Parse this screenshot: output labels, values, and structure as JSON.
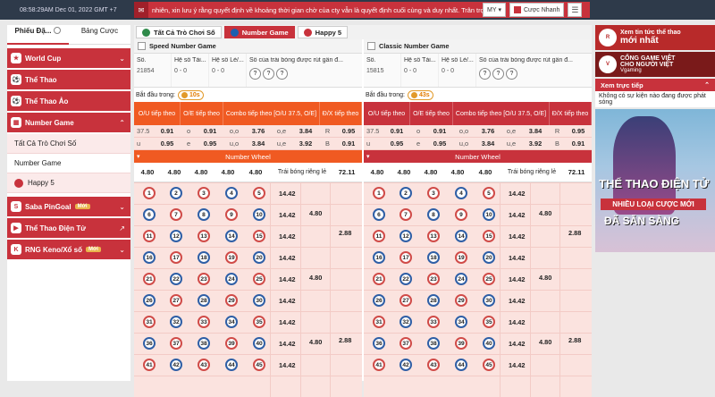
{
  "topbar": {
    "datetime": "08:58:29AM Dec 01, 2022 GMT +7",
    "marquee": "nhiên, xin lưu ý rằng quyết định về khoảng thời gian chờ của cty vẫn là quyết định cuối cùng và duy nhất. Trân trọng.",
    "lang": "MY",
    "quick_bet": "Cược Nhanh"
  },
  "sidebar": {
    "tabs": [
      "Phiếu Đặ...",
      "Bảng Cược"
    ],
    "items": [
      {
        "label": "World Cup"
      },
      {
        "label": "Thể Thao"
      },
      {
        "label": "Thể Thao Ảo"
      },
      {
        "label": "Number Game"
      }
    ],
    "subitems": [
      "Tất Cả Trò Chơi Số",
      "Number Game",
      "Happy 5"
    ],
    "bottom": [
      {
        "label": "Saba PinGoal",
        "badge": "Mới"
      },
      {
        "label": "Thể Thao Điện Tử"
      },
      {
        "label": "RNG Keno/Xổ số",
        "badge": "Mới"
      }
    ]
  },
  "game_tabs": [
    "Tất Cả Trò Chơi Số",
    "Number Game",
    "Happy 5"
  ],
  "panels": [
    {
      "title": "Speed Number Game",
      "head": {
        "so_label": "Số.",
        "so_value": "21854",
        "tai_label": "Hệ số Tài...",
        "tai_value": "0 - 0",
        "le_label": "Hệ số Lẻ/...",
        "le_value": "0 - 0",
        "draw_label": "Số của trái bóng được rút gần đ...",
        "balls": [
          "?",
          "?",
          "?"
        ]
      },
      "start_label": "Bắt đầu trong:",
      "timer": "10s",
      "cols": [
        "O/U tiếp theo",
        "O/E tiếp theo",
        "Combo tiếp theo [O/U 37.5, O/E]",
        "Đ/X tiếp theo"
      ],
      "rows": [
        {
          "a": "37.5",
          "b": "0.91",
          "c": "o",
          "d": "0.91",
          "e": "o,o",
          "f": "3.76",
          "g": "o,e",
          "h": "3.84",
          "i": "R",
          "j": "0.95"
        },
        {
          "a": "u",
          "b": "0.95",
          "c": "e",
          "d": "0.95",
          "e": "u,o",
          "f": "3.84",
          "g": "u,e",
          "h": "3.92",
          "i": "B",
          "j": "0.91"
        }
      ],
      "wheel_title": "Number Wheel",
      "wheel_sum": [
        "4.80",
        "4.80",
        "4.80",
        "4.80",
        "4.80",
        "Trái bóng riêng lẻ",
        "72.11"
      ],
      "grid_odds": {
        "a": "14.42",
        "b": "4.80",
        "c": "2.88"
      }
    },
    {
      "title": "Classic Number Game",
      "head": {
        "so_label": "Số.",
        "so_value": "15815",
        "tai_label": "Hệ số Tài...",
        "tai_value": "0 - 0",
        "le_label": "Hệ số Lẻ/...",
        "le_value": "0 - 0",
        "draw_label": "Số của trái bóng được rút gần đ...",
        "balls": [
          "?",
          "?",
          "?"
        ]
      },
      "start_label": "Bắt đầu trong:",
      "timer": "43s",
      "cols": [
        "O/U tiếp theo",
        "O/E tiếp theo",
        "Combo tiếp theo [O/U 37.5, O/E]",
        "Đ/X tiếp theo"
      ],
      "rows": [
        {
          "a": "37.5",
          "b": "0.91",
          "c": "o",
          "d": "0.91",
          "e": "o,o",
          "f": "3.76",
          "g": "o,e",
          "h": "3.84",
          "i": "R",
          "j": "0.95"
        },
        {
          "a": "u",
          "b": "0.95",
          "c": "e",
          "d": "0.95",
          "e": "u,o",
          "f": "3.84",
          "g": "u,e",
          "h": "3.92",
          "i": "B",
          "j": "0.91"
        }
      ],
      "wheel_title": "Number Wheel",
      "wheel_sum": [
        "4.80",
        "4.80",
        "4.80",
        "4.80",
        "4.80",
        "Trái bóng riêng lẻ",
        "72.11"
      ],
      "grid_odds": {
        "a": "14.42",
        "b": "4.80",
        "c": "2.88"
      }
    }
  ],
  "numbers": [
    1,
    2,
    3,
    4,
    5,
    6,
    7,
    8,
    9,
    10,
    11,
    12,
    13,
    14,
    15,
    16,
    17,
    18,
    19,
    20,
    21,
    22,
    23,
    24,
    25,
    26,
    27,
    28,
    29,
    30,
    31,
    32,
    33,
    34,
    35,
    36,
    37,
    38,
    39,
    40,
    41,
    42,
    43,
    44,
    45
  ],
  "blue_numbers": [
    2,
    4,
    6,
    8,
    10,
    12,
    14,
    16,
    18,
    20,
    22,
    24,
    26,
    28,
    30,
    32,
    34,
    36,
    38,
    40,
    42,
    44
  ],
  "right": {
    "ad1": {
      "small": "Xem tin tức thể thao",
      "big": "mới nhất"
    },
    "ad2": {
      "line1": "CỔNG GAME VIỆT",
      "line2": "CHO NGƯỜI VIỆT",
      "brand": "Vgaming"
    },
    "live_title": "Xem trực tiếp",
    "no_live": "Không có sự kiện nào đang được phát sóng",
    "banner": {
      "t1": "THỂ THAO ĐIỆN TỬ",
      "t2": "NHIỀU LOẠI CƯỢC MỚI",
      "t3": "ĐÃ SẴN SÀNG"
    }
  }
}
